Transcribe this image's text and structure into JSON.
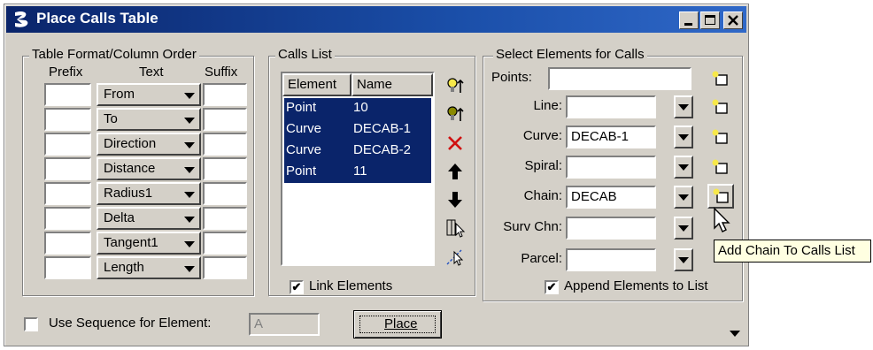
{
  "window": {
    "title": "Place Calls Table"
  },
  "title_buttons": [
    "minimize",
    "maximize",
    "close"
  ],
  "table_format": {
    "group_title": "Table Format/Column Order",
    "headers": {
      "prefix": "Prefix",
      "text": "Text",
      "suffix": "Suffix"
    },
    "rows": [
      {
        "prefix": "",
        "text": "From",
        "suffix": ""
      },
      {
        "prefix": "",
        "text": "To",
        "suffix": ""
      },
      {
        "prefix": "",
        "text": "Direction",
        "suffix": ""
      },
      {
        "prefix": "",
        "text": "Distance",
        "suffix": ""
      },
      {
        "prefix": "",
        "text": "Radius1",
        "suffix": ""
      },
      {
        "prefix": "",
        "text": "Delta",
        "suffix": ""
      },
      {
        "prefix": "",
        "text": "Tangent1",
        "suffix": ""
      },
      {
        "prefix": "",
        "text": "Length",
        "suffix": ""
      }
    ]
  },
  "calls_list": {
    "group_title": "Calls List",
    "columns": [
      "Element",
      "Name"
    ],
    "rows": [
      {
        "element": "Point",
        "name": "10"
      },
      {
        "element": "Curve",
        "name": "DECAB-1"
      },
      {
        "element": "Curve",
        "name": "DECAB-2"
      },
      {
        "element": "Point",
        "name": "11"
      }
    ],
    "link_elements_label": "Link Elements",
    "link_elements_checked": true,
    "check_mark": "✔"
  },
  "select_elements": {
    "group_title": "Select Elements for Calls",
    "points_label": "Points:",
    "points_value": "",
    "fields": [
      {
        "label": "Line:",
        "value": ""
      },
      {
        "label": "Curve:",
        "value": "DECAB-1"
      },
      {
        "label": "Spiral:",
        "value": ""
      },
      {
        "label": "Chain:",
        "value": "DECAB"
      },
      {
        "label": "Surv Chn:",
        "value": ""
      },
      {
        "label": "Parcel:",
        "value": ""
      }
    ],
    "append_label": "Append Elements to List",
    "append_checked": true,
    "check_mark": "✔"
  },
  "bottom": {
    "use_sequence_label": "Use Sequence for Element:",
    "use_sequence_checked": false,
    "sequence_value": "A",
    "place_label": "Place"
  },
  "tooltip": "Add Chain To Calls List"
}
